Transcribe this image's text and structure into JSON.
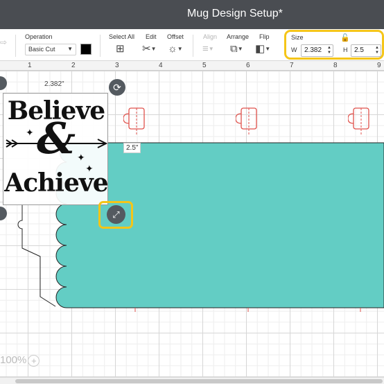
{
  "window": {
    "title": "Mug Design Setup*"
  },
  "toolbar": {
    "operation_label": "Operation",
    "operation_value": "Basic Cut",
    "select_all_label": "Select All",
    "edit_label": "Edit",
    "offset_label": "Offset",
    "align_label": "Align",
    "arrange_label": "Arrange",
    "flip_label": "Flip",
    "size_label": "Size",
    "width_prefix": "W",
    "width_value": "2.382",
    "height_prefix": "H",
    "height_value": "2.5",
    "material_color": "#000000"
  },
  "ruler": {
    "ticks": [
      "1",
      "2",
      "3",
      "4",
      "5",
      "6",
      "7",
      "8",
      "9"
    ]
  },
  "canvas": {
    "design_lines": [
      "Believe",
      "&",
      "Achieve"
    ],
    "width_readout": "2.382\"",
    "height_readout": "2.5\"",
    "background_color": "#63cdc4",
    "mug_color": "#e0524c"
  },
  "zoom": {
    "value": "100%",
    "plus_symbol": "+"
  }
}
